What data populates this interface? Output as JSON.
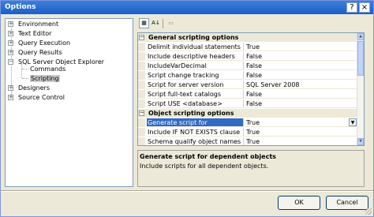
{
  "window": {
    "title": "Options",
    "help_label": "?",
    "close_label": "×"
  },
  "tree": {
    "items": [
      {
        "label": "Environment",
        "expander": "+"
      },
      {
        "label": "Text Editor",
        "expander": "+"
      },
      {
        "label": "Query Execution",
        "expander": "+"
      },
      {
        "label": "Query Results",
        "expander": "+"
      },
      {
        "label": "SQL Server Object Explorer",
        "expander": "−"
      },
      {
        "label": "Commands"
      },
      {
        "label": "Scripting"
      },
      {
        "label": "Designers",
        "expander": "+"
      },
      {
        "label": "Source Control",
        "expander": "+"
      }
    ]
  },
  "toolbar": {
    "categorized_icon": "▦",
    "alpha_icon": "A↓",
    "pages_icon": "▭"
  },
  "grid": {
    "categories": [
      {
        "label": "General scripting options",
        "expander": "−",
        "rows": [
          {
            "name": "Delimit individual statements",
            "value": "True"
          },
          {
            "name": "Include descriptive headers",
            "value": "False"
          },
          {
            "name": "IncludeVarDecimal",
            "value": "False"
          },
          {
            "name": "Script change tracking",
            "value": "False"
          },
          {
            "name": "Script for server version",
            "value": "SQL Server 2008"
          },
          {
            "name": "Script full-text catalogs",
            "value": "False"
          },
          {
            "name": "Script USE <database>",
            "value": "False"
          }
        ]
      },
      {
        "label": "Object scripting options",
        "expander": "−",
        "rows": [
          {
            "name": "Generate script for dependent ob",
            "value": "True"
          },
          {
            "name": "Include IF NOT EXISTS clause",
            "value": "True"
          },
          {
            "name": "Schema qualify object names",
            "value": "True"
          }
        ]
      }
    ],
    "dropdown_glyph": "▼",
    "scroll_up": "▲",
    "scroll_down": "▼"
  },
  "description": {
    "title": "Generate script for dependent objects",
    "text": "Include scripts for all dependent objects."
  },
  "buttons": {
    "ok": "OK",
    "cancel": "Cancel"
  }
}
